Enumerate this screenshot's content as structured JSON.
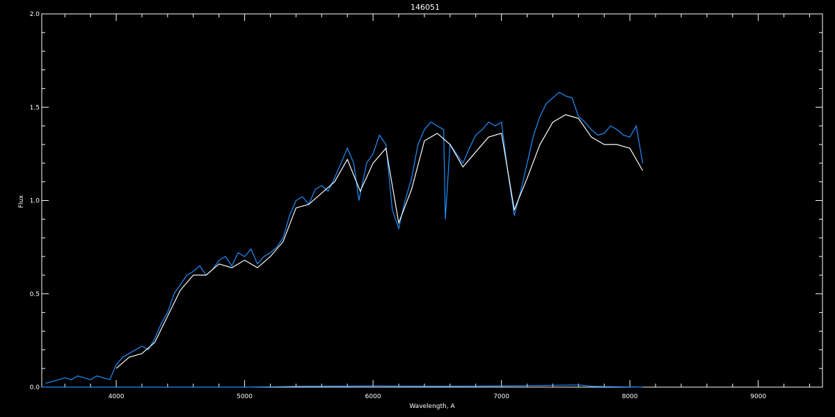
{
  "chart_data": {
    "type": "line",
    "title": "146051",
    "xlabel": "Wavelength, A",
    "ylabel": "Flux",
    "xlim": [
      3420,
      9500
    ],
    "ylim": [
      0.0,
      2.0
    ],
    "x_ticks": [
      4000,
      5000,
      6000,
      7000,
      8000,
      9000
    ],
    "x_tick_labels": [
      "4000",
      "5000",
      "6000",
      "7000",
      "8000",
      "9000"
    ],
    "y_ticks": [
      0.0,
      0.5,
      1.0,
      1.5,
      2.0
    ],
    "y_tick_labels": [
      "0.0",
      "0.5",
      "1.0",
      "1.5",
      "2.0"
    ],
    "grid": false,
    "background": "#000000",
    "axis_color": "#ffffff",
    "series": [
      {
        "color": "#1e90ff",
        "x": [
          3450,
          3500,
          3550,
          3600,
          3650,
          3700,
          3750,
          3800,
          3850,
          3900,
          3950,
          4000,
          4050,
          4100,
          4150,
          4200,
          4250,
          4300,
          4350,
          4400,
          4450,
          4500,
          4550,
          4600,
          4650,
          4700,
          4750,
          4800,
          4850,
          4900,
          4950,
          5000,
          5050,
          5100,
          5150,
          5200,
          5250,
          5300,
          5350,
          5400,
          5450,
          5500,
          5550,
          5600,
          5650,
          5700,
          5750,
          5800,
          5850,
          5890,
          5950,
          6000,
          6050,
          6100,
          6150,
          6200,
          6250,
          6300,
          6350,
          6400,
          6450,
          6500,
          6550,
          6563,
          6600,
          6650,
          6700,
          6750,
          6800,
          6850,
          6900,
          6950,
          7000,
          7050,
          7100,
          7150,
          7200,
          7250,
          7300,
          7350,
          7400,
          7450,
          7500,
          7550,
          7600,
          7650,
          7700,
          7750,
          7800,
          7850,
          7900,
          7950,
          8000,
          8050,
          8100
        ],
        "y": [
          0.02,
          0.03,
          0.04,
          0.05,
          0.04,
          0.06,
          0.05,
          0.04,
          0.06,
          0.05,
          0.04,
          0.12,
          0.16,
          0.18,
          0.2,
          0.22,
          0.2,
          0.26,
          0.34,
          0.4,
          0.5,
          0.55,
          0.6,
          0.62,
          0.65,
          0.6,
          0.63,
          0.68,
          0.7,
          0.65,
          0.72,
          0.7,
          0.74,
          0.66,
          0.7,
          0.72,
          0.75,
          0.8,
          0.92,
          1.0,
          1.02,
          0.98,
          1.06,
          1.08,
          1.05,
          1.12,
          1.2,
          1.28,
          1.2,
          1.0,
          1.2,
          1.25,
          1.35,
          1.3,
          0.95,
          0.85,
          1.0,
          1.12,
          1.3,
          1.38,
          1.42,
          1.4,
          1.38,
          0.9,
          1.3,
          1.25,
          1.2,
          1.28,
          1.35,
          1.38,
          1.42,
          1.4,
          1.42,
          1.15,
          0.92,
          1.05,
          1.2,
          1.35,
          1.45,
          1.52,
          1.55,
          1.58,
          1.56,
          1.55,
          1.45,
          1.42,
          1.38,
          1.35,
          1.36,
          1.4,
          1.38,
          1.35,
          1.34,
          1.4,
          1.2
        ]
      },
      {
        "color": "#ffffff",
        "x": [
          4000,
          4100,
          4200,
          4300,
          4400,
          4500,
          4600,
          4700,
          4800,
          4900,
          5000,
          5100,
          5200,
          5300,
          5400,
          5500,
          5600,
          5700,
          5800,
          5900,
          6000,
          6100,
          6200,
          6300,
          6400,
          6500,
          6600,
          6700,
          6800,
          6900,
          7000,
          7100,
          7200,
          7300,
          7400,
          7500,
          7600,
          7700,
          7800,
          7900,
          8000,
          8100
        ],
        "y": [
          0.1,
          0.16,
          0.18,
          0.24,
          0.38,
          0.52,
          0.6,
          0.6,
          0.66,
          0.64,
          0.68,
          0.64,
          0.7,
          0.78,
          0.96,
          0.98,
          1.04,
          1.1,
          1.22,
          1.05,
          1.2,
          1.28,
          0.88,
          1.06,
          1.32,
          1.36,
          1.3,
          1.18,
          1.26,
          1.34,
          1.36,
          0.95,
          1.12,
          1.3,
          1.42,
          1.46,
          1.44,
          1.34,
          1.3,
          1.3,
          1.28,
          1.16
        ]
      },
      {
        "color": "#1e90ff",
        "x": [
          3420,
          4000,
          5000,
          5500,
          6000,
          6500,
          7000,
          7600,
          7700,
          8100
        ],
        "y": [
          0.0,
          0.0,
          0.0,
          0.005,
          0.006,
          0.005,
          0.006,
          0.012,
          0.004,
          0.0
        ]
      }
    ]
  }
}
